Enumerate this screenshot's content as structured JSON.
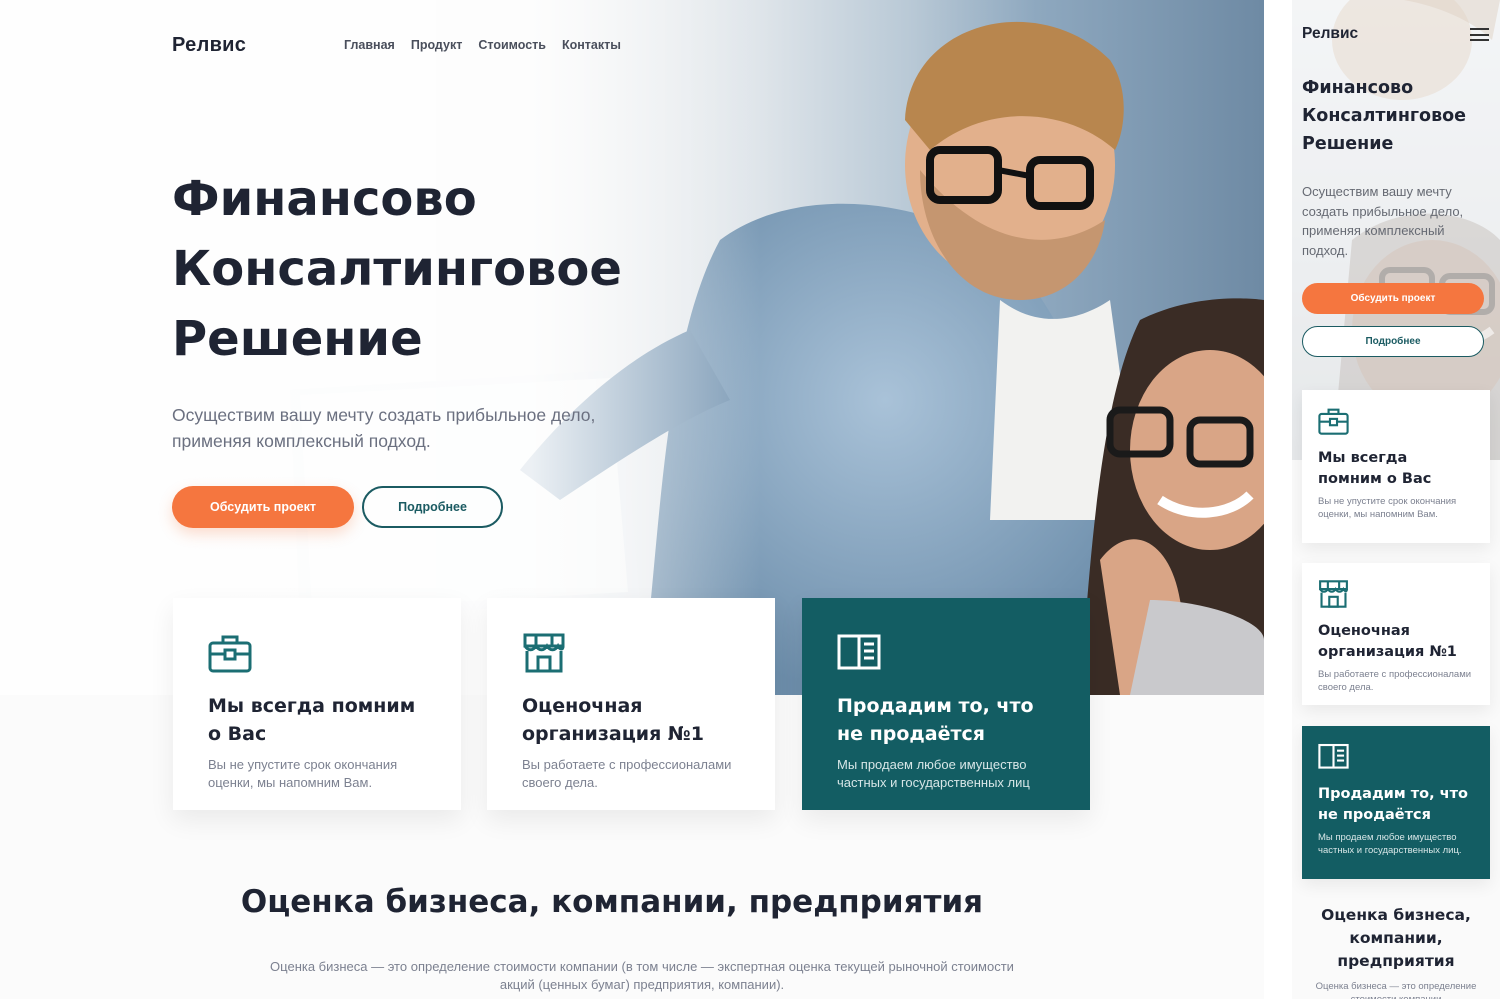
{
  "desktop": {
    "logo": "Релвис",
    "nav": [
      "Главная",
      "Продукт",
      "Стоимость",
      "Контакты"
    ],
    "hero": {
      "title_lines": [
        "Финансово",
        "Консалтинговое",
        "Решение"
      ],
      "subtitle": "Осуществим вашу мечту создать прибыльное дело, применяя комплексный подход.",
      "primary_button": "Обсудить проект",
      "secondary_button": "Подробнее"
    },
    "features": [
      {
        "icon": "briefcase-icon",
        "title": "Мы всегда помним о Вас",
        "text": "Вы не упустите срок окончания оценки, мы напомним Вам."
      },
      {
        "icon": "storefront-icon",
        "title": "Оценочная организация №1",
        "text": "Вы работаете с профессионалами своего дела."
      },
      {
        "icon": "book-icon",
        "title": "Продадим то, что не продаётся",
        "text": "Мы продаем любое имущество частных и государственных лиц"
      }
    ],
    "section": {
      "title": "Оценка бизнеса, компании, предприятия",
      "text": "Оценка бизнеса — это определение стоимости компании (в том числе — экспертная оценка текущей рыночной стоимости акций (ценных бумаг) предприятия, компании)."
    }
  },
  "mobile": {
    "logo": "Релвис",
    "menu_icon": "hamburger-menu-icon",
    "hero": {
      "title_lines": [
        "Финансово",
        "Консалтинговое",
        "Решение"
      ],
      "subtitle": "Осуществим вашу мечту создать прибыльное дело, применяя комплексный подход.",
      "primary_button": "Обсудить проект",
      "secondary_button": "Подробнее"
    },
    "features": [
      {
        "icon": "briefcase-icon",
        "title": "Мы всегда помним о Вас",
        "text": "Вы не упустите срок окончания оценки, мы напомним Вам."
      },
      {
        "icon": "storefront-icon",
        "title": "Оценочная организация №1",
        "text": "Вы работаете с профессионалами своего дела."
      },
      {
        "icon": "book-icon",
        "title": "Продадим то, что не продаётся",
        "text": "Мы продаем любое имущество частных и государственных лиц."
      }
    ],
    "section": {
      "title": "Оценка бизнеса, компании, предприятия",
      "text": "Оценка бизнеса — это определение стоимости компании"
    }
  },
  "colors": {
    "accent_orange": "#f5763f",
    "brand_teal": "#135d63",
    "text_dark": "#1f2433",
    "text_muted": "#7c8190"
  }
}
